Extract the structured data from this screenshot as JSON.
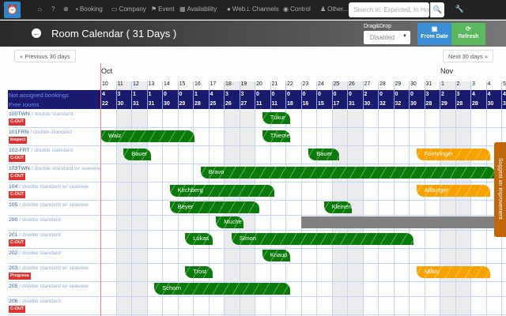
{
  "nav": {
    "items": [
      {
        "icon": "home-icon",
        "label": ""
      },
      {
        "icon": "help-icon",
        "label": ""
      },
      {
        "icon": "zoom-icon",
        "label": ""
      },
      {
        "icon": "briefcase-icon",
        "label": "Booking"
      },
      {
        "icon": "folder-icon",
        "label": "Company"
      },
      {
        "icon": "flag-icon",
        "label": "Event"
      },
      {
        "icon": "calendar-icon",
        "label": "Availability"
      },
      {
        "icon": "globe-icon",
        "label": "Web"
      },
      {
        "icon": "sitemap-icon",
        "label": "Channels"
      },
      {
        "icon": "eye-icon",
        "label": "Control"
      },
      {
        "icon": "user-icon",
        "label": "Other..."
      }
    ],
    "search_placeholder": "Search in: Expected, In Hote"
  },
  "header": {
    "title": "Room Calendar ( 31 Days )",
    "dragdrop_label": "Drag&Drop",
    "dragdrop_value": "Disabled",
    "from_date": "From Date",
    "refresh": "Refresh",
    "from_date_color": "#3a8fd6",
    "refresh_color": "#5cb85c"
  },
  "pager": {
    "prev": "« Previous 30 days",
    "next": "Next 30 days »"
  },
  "months": [
    {
      "label": "Oct",
      "day_index": 0
    },
    {
      "label": "Nov",
      "day_index": 22
    }
  ],
  "days": [
    "10",
    "11",
    "12",
    "13",
    "14",
    "15",
    "16",
    "17",
    "18",
    "19",
    "20",
    "21",
    "22",
    "23",
    "24",
    "25",
    "26",
    "27",
    "28",
    "29",
    "30",
    "31",
    "1",
    "2",
    "3",
    "4",
    "5"
  ],
  "weekend_index": [
    1,
    2,
    8,
    9,
    15,
    16,
    22,
    23
  ],
  "not_assigned": {
    "label": "Not assigned bookings",
    "values": [
      "4",
      "3",
      "1",
      "1",
      "0",
      "0",
      "1",
      "4",
      "3",
      "3",
      "0",
      "0",
      "0",
      "0",
      "0",
      "0",
      "0",
      "2",
      "0",
      "0",
      "0",
      "3",
      "2",
      "3",
      "4",
      "4",
      "4"
    ]
  },
  "free_rooms": {
    "label": "Free rooms",
    "values": [
      "22",
      "30",
      "31",
      "31",
      "30",
      "29",
      "28",
      "25",
      "26",
      "27",
      "11",
      "11",
      "18",
      "16",
      "15",
      "17",
      "31",
      "30",
      "32",
      "32",
      "30",
      "28",
      "29",
      "28",
      "28",
      "30",
      "30"
    ]
  },
  "rooms": [
    {
      "number": "100TWN",
      "type": "double standard",
      "badge": "C-OUT",
      "bookings": [
        {
          "guest": "Tukur",
          "start": 10.5,
          "nights": 2,
          "color": "green"
        }
      ]
    },
    {
      "number": "101FRN",
      "type": "double standard",
      "badge": "Inspect",
      "bookings": [
        {
          "guest": "Walz",
          "start": 0,
          "nights": 6.3,
          "color": "green"
        },
        {
          "guest": "Thieme",
          "start": 10.5,
          "nights": 2,
          "color": "green"
        }
      ]
    },
    {
      "number": "102-FRT",
      "type": "double standard",
      "badge": "C-OUT",
      "bookings": [
        {
          "guest": "Bauer",
          "start": 1.5,
          "nights": 2,
          "color": "green"
        },
        {
          "guest": "Bauer",
          "start": 13.5,
          "nights": 2.2,
          "color": "green"
        },
        {
          "guest": "Foehringer",
          "start": 20.5,
          "nights": 5,
          "color": "orange"
        }
      ]
    },
    {
      "number": "103TWN",
      "type": "double standard w/ seaview",
      "badge": "C-OUT",
      "bookings": [
        {
          "guest": "Bravo",
          "start": 6.5,
          "nights": 19.3,
          "color": "green"
        }
      ]
    },
    {
      "number": "104",
      "type": "double standard w/ seaview",
      "badge": "C-OUT",
      "bookings": [
        {
          "guest": "Kirchberg",
          "start": 4.5,
          "nights": 7,
          "color": "green"
        },
        {
          "guest": "Allburger",
          "start": 20.5,
          "nights": 5,
          "color": "orange"
        }
      ]
    },
    {
      "number": "105",
      "type": "double standard w/ seaview",
      "badge": "",
      "bookings": [
        {
          "guest": "Beyer",
          "start": 4.5,
          "nights": 6,
          "color": "green"
        },
        {
          "guest": "Kleinert",
          "start": 14.5,
          "nights": 2,
          "color": "green"
        }
      ]
    },
    {
      "number": "200",
      "type": "double standard",
      "badge": "",
      "bookings": [
        {
          "guest": "Muche",
          "start": 7.5,
          "nights": 2,
          "color": "green"
        },
        {
          "guest": "",
          "start": 13,
          "nights": 14,
          "color": "gray"
        }
      ]
    },
    {
      "number": "201",
      "type": "double standard",
      "badge": "C-OUT",
      "bookings": [
        {
          "guest": "Lukas",
          "start": 5.5,
          "nights": 2,
          "color": "green"
        },
        {
          "guest": "Simon",
          "start": 8.5,
          "nights": 12,
          "color": "green"
        }
      ]
    },
    {
      "number": "202",
      "type": "double standard",
      "badge": "",
      "bookings": [
        {
          "guest": "Knaup",
          "start": 10.5,
          "nights": 2,
          "color": "green"
        }
      ]
    },
    {
      "number": "203",
      "type": "double standard w/ seaview",
      "badge": "Progress",
      "bookings": [
        {
          "guest": "Trost",
          "start": 5.5,
          "nights": 2,
          "color": "green"
        },
        {
          "guest": "Milloy",
          "start": 20.5,
          "nights": 5,
          "color": "orange"
        }
      ]
    },
    {
      "number": "205",
      "type": "double standard w/ seaview",
      "badge": "",
      "bookings": [
        {
          "guest": "Schorn",
          "start": 3.5,
          "nights": 9,
          "color": "green"
        }
      ]
    },
    {
      "number": "206",
      "type": "double standard",
      "badge": "C-OUT",
      "bookings": []
    }
  ],
  "suggest": "Suggest an improvement"
}
